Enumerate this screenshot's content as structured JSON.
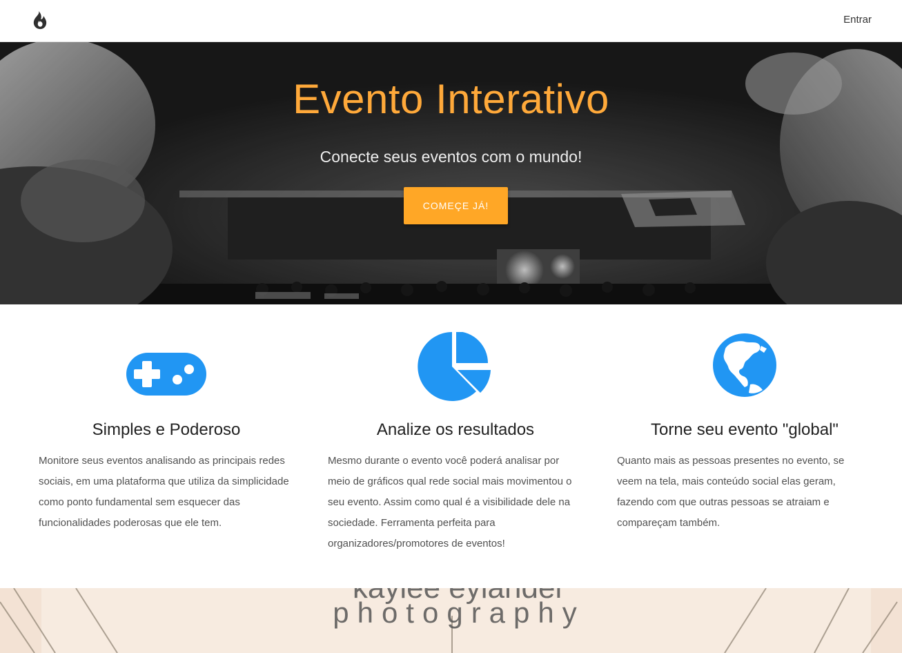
{
  "navbar": {
    "logo_icon": "flame-icon",
    "login_label": "Entrar"
  },
  "hero": {
    "title": "Evento Interativo",
    "subtitle": "Conecte seus eventos com o mundo!",
    "cta_label": "COMEÇE JÁ!",
    "accent_color": "#ffa726"
  },
  "features": [
    {
      "icon": "gamepad-icon",
      "title": "Simples e Poderoso",
      "text": "Monitore seus eventos analisando as principais redes sociais, em uma plataforma que utiliza da simplicidade como ponto fundamental sem esquecer das funcionalidades poderosas que ele tem."
    },
    {
      "icon": "pie-chart-icon",
      "title": "Analize os resultados",
      "text": "Mesmo durante o evento você poderá analisar por meio de gráficos qual rede social mais movimentou o seu evento. Assim como qual é a visibilidade dele na sociedade. Ferramenta perfeita para organizadores/promotores de eventos!"
    },
    {
      "icon": "globe-icon",
      "title": "Torne seu evento \"global\"",
      "text": "Quanto mais as pessoas presentes no evento, se veem na tela, mais conteúdo social elas geram, fazendo com que outras pessoas se atraiam e compareçam também."
    }
  ],
  "bottom_band": {
    "watermark_line1": "kaylee eylander",
    "watermark_line2": "photography"
  },
  "colors": {
    "icon_blue": "#2196f3",
    "title_orange": "#ffa93a"
  }
}
